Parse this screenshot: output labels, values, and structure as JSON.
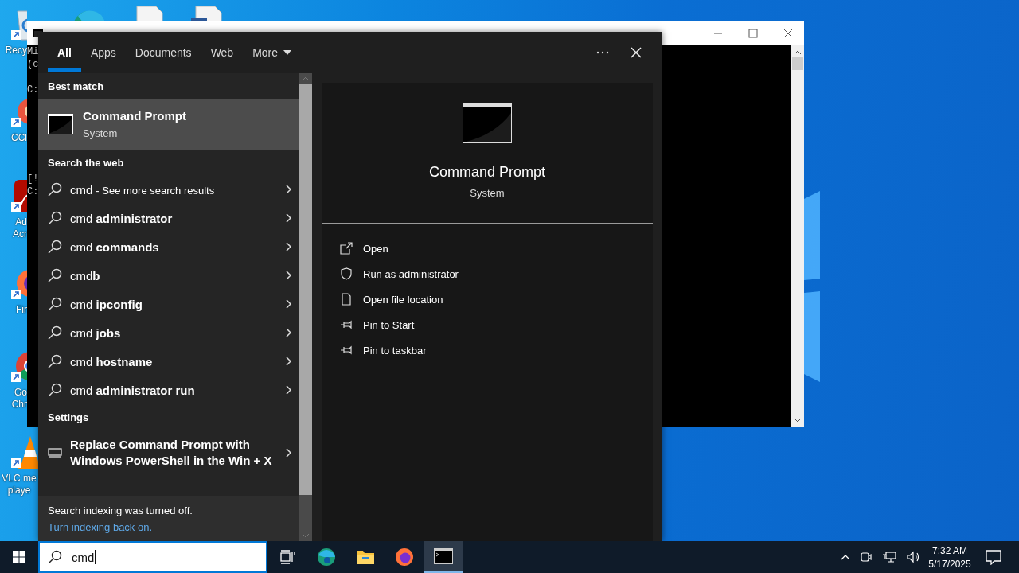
{
  "desktop": {
    "icons": [
      {
        "kind": "recycle-bin",
        "lines": [
          "Recy"
        ]
      },
      {
        "kind": "ccleaner",
        "lines": [
          "CCl"
        ]
      },
      {
        "kind": "acrobat",
        "lines": [
          "Ad",
          "Acr"
        ]
      },
      {
        "kind": "firefox",
        "lines": [
          "Fir"
        ]
      },
      {
        "kind": "chrome",
        "lines": [
          "Go",
          "Chr"
        ]
      },
      {
        "kind": "vlc",
        "lines": [
          "VLC me",
          "playe"
        ]
      }
    ]
  },
  "console_window": {
    "blocks": [
      [
        "Mi",
        "(c"
      ],
      [
        "C:"
      ],
      [
        "[!",
        "C:"
      ]
    ]
  },
  "search_panel": {
    "tabs": [
      {
        "label": "All",
        "kind": "tab",
        "selected": true
      },
      {
        "label": "Apps",
        "kind": "tab",
        "selected": false
      },
      {
        "label": "Documents",
        "kind": "tab",
        "selected": false
      },
      {
        "label": "Web",
        "kind": "tab",
        "selected": false
      },
      {
        "label": "More",
        "kind": "dropdown",
        "selected": false
      }
    ],
    "best_match": {
      "heading": "Best match",
      "title": "Command Prompt",
      "subtitle": "System",
      "selected": true
    },
    "web": {
      "heading": "Search the web",
      "results": [
        {
          "text": "cmd",
          "note": "- See more search results"
        },
        {
          "text": "cmd **administrator**"
        },
        {
          "text": "cmd **commands**"
        },
        {
          "text": "cmd**b**"
        },
        {
          "text": "cmd **ipconfig**"
        },
        {
          "text": "cmd **jobs**"
        },
        {
          "text": "cmd **hostname**"
        },
        {
          "text": "cmd **administrator run**"
        }
      ]
    },
    "settings": {
      "heading": "Settings",
      "results": [
        {
          "text": "Replace Command Prompt with Windows PowerShell in the Win + X"
        }
      ]
    },
    "footer": {
      "message": "Search indexing was turned off.",
      "link": "Turn indexing back on."
    },
    "preview": {
      "title": "Command Prompt",
      "subtitle": "System",
      "actions": [
        {
          "kind": "open",
          "label": "Open"
        },
        {
          "kind": "shield",
          "label": "Run as administrator"
        },
        {
          "kind": "file",
          "label": "Open file location"
        },
        {
          "kind": "pin",
          "label": "Pin to Start"
        },
        {
          "kind": "pin",
          "label": "Pin to taskbar"
        }
      ]
    }
  },
  "taskbar": {
    "search": {
      "value": "cmd"
    },
    "apps": [
      {
        "kind": "task-view",
        "active": false
      },
      {
        "kind": "edge",
        "active": false
      },
      {
        "kind": "explorer",
        "active": false
      },
      {
        "kind": "firefox",
        "active": false
      },
      {
        "kind": "console",
        "active": true
      }
    ],
    "clock": {
      "time": "7:32 AM",
      "date": "5/17/2025"
    }
  }
}
